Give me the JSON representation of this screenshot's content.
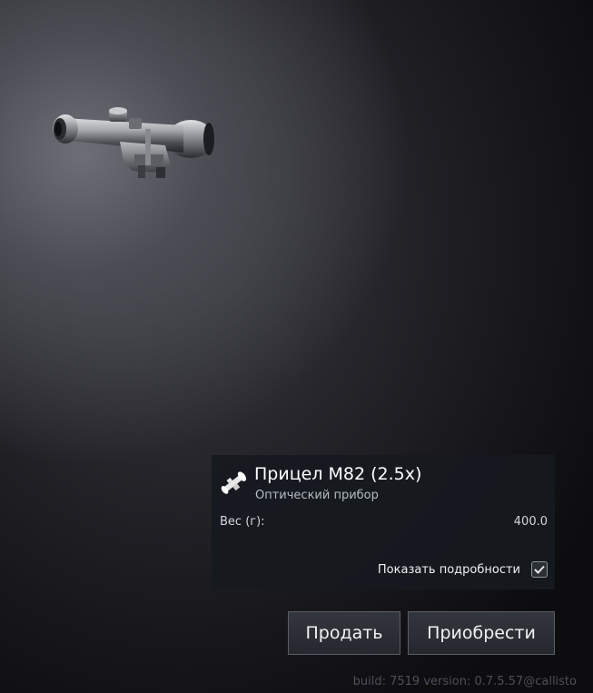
{
  "item": {
    "image": "scope-m82-image",
    "icon": "scope-icon",
    "title": "Прицел М82 (2.5x)",
    "subtitle": "Оптический прибор",
    "stats": [
      {
        "label": "Вес (г):",
        "value": "400.0"
      }
    ]
  },
  "details": {
    "label": "Показать подробности",
    "checked": true
  },
  "actions": {
    "sell_label": "Продать",
    "buy_label": "Приобрести"
  },
  "footer": {
    "build_info": "build: 7519 version: 0.7.5.57@callisto"
  },
  "colors": {
    "panel_bg": "#161a20",
    "title": "#ffffff",
    "subtitle": "#b6bcc4",
    "build_text": "#4c5058"
  }
}
